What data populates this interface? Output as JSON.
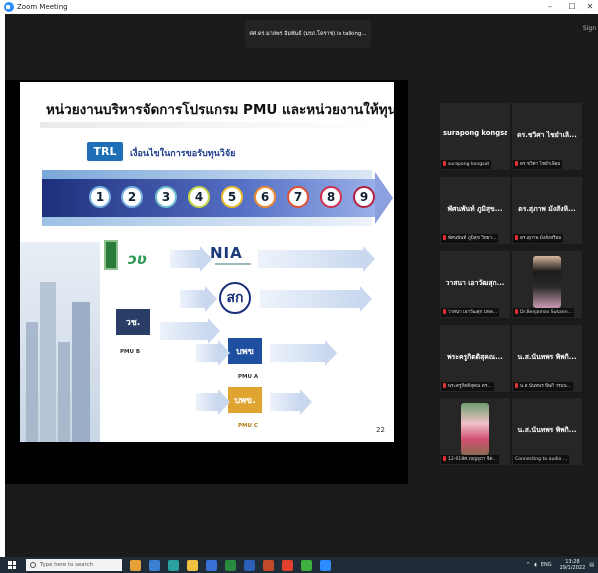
{
  "window": {
    "title": "Zoom Meeting",
    "controls": [
      "–",
      "☐",
      "✕"
    ]
  },
  "banner": {
    "speaking": "ศศ.ดร.มาลพร อิมพันธ์ (มรภ.โคราช) is talking..."
  },
  "sign": "Sign",
  "slide": {
    "heading": "หน่วยงานบริหารจัดการโปรแกรม PMU และหน่วยงานให้ทุนอื่นๆ",
    "trl_badge": "TRL",
    "trl_subtitle": "เงื่อนไขในการขอรับทุนวิจัย",
    "levels": [
      "1",
      "2",
      "3",
      "4",
      "5",
      "6",
      "7",
      "8",
      "9"
    ],
    "logos": {
      "nia": "NIA",
      "sor": "สก",
      "wch": "วช.",
      "pmu_a_mark": "บพข",
      "pmu_c_mark": "บพข."
    },
    "labels": {
      "pmu_b": "PMU B",
      "pmu_a": "PMU A",
      "pmu_c": "PMU C"
    },
    "page": "22"
  },
  "participants": [
    {
      "display": "surapong kongsat",
      "caption": "surapong kongsat",
      "video": false
    },
    {
      "display": "ดร.ชวิศา ไชยำเลิ...",
      "caption": "ดร.ชวิศา ไชยำเลิอม",
      "video": false
    },
    {
      "display": "พัศนพันท์ ภูมิสุข...",
      "caption": "พัศนพันท์ ภูมิสุข วิทยา...",
      "video": false
    },
    {
      "display": "ดร.สุภาพ มังสังหิ...",
      "caption": "ดร.สุภาพ มังสังหริอม",
      "video": false
    },
    {
      "display": "วาสนา เอาวัฒสุก...",
      "caption": "วาสนา เอาวัฒสุก มหล...",
      "video": false
    },
    {
      "display": "",
      "caption": "Dr.Benjamas Sukann...",
      "video": true
    },
    {
      "display": "พระครูกิตติสุคณ...",
      "caption": "พระครูกิตติสุคณ ดร...",
      "video": false
    },
    {
      "display": "น.ส.นันทพร พิพกิ...",
      "caption": "น.ส.นันทพร พิพกิ วรมน...",
      "video": false
    },
    {
      "display": "",
      "caption": "12-018ศ.เบญจุภา จิต...",
      "video": true
    },
    {
      "display": "น.ส.นันทพร พิพกิ...",
      "caption": "Connecting to audio ...",
      "video": false
    }
  ],
  "taskbar": {
    "search_placeholder": "Type here to search",
    "tray": {
      "lang": "ENG",
      "time": "13:28",
      "date": "29/1/2022"
    }
  }
}
